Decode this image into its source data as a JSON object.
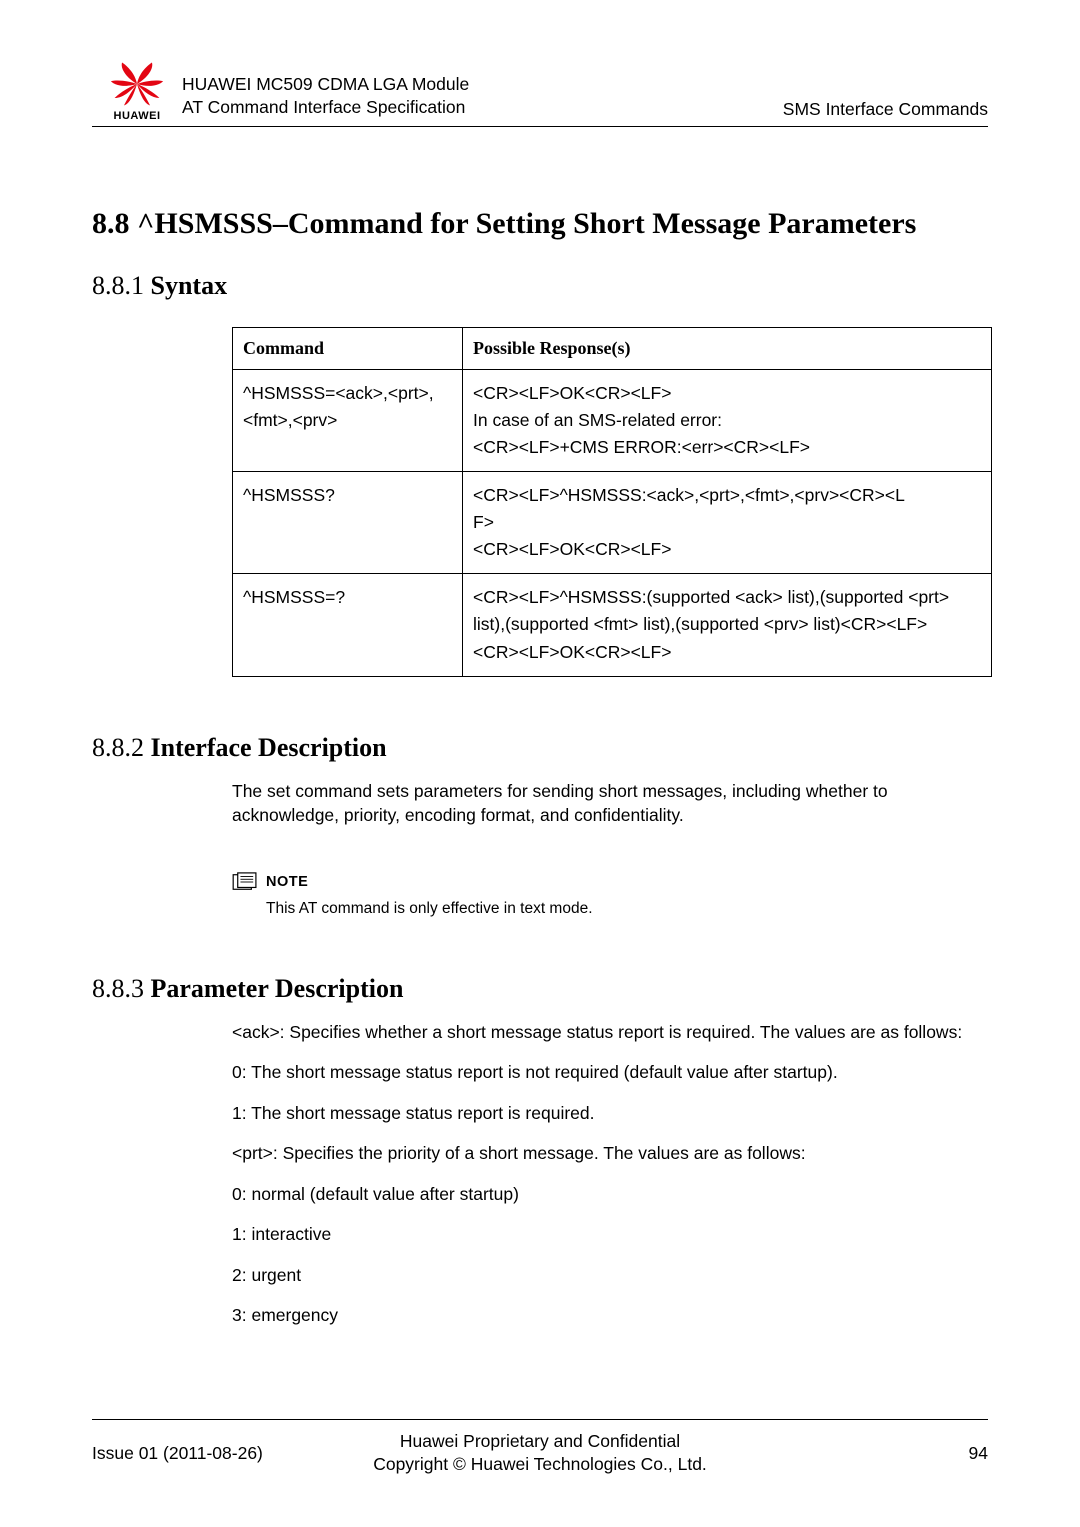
{
  "header": {
    "logo_text": "HUAWEI",
    "title_line1": "HUAWEI MC509 CDMA LGA Module",
    "title_line2": "AT Command Interface Specification",
    "right": "SMS Interface Commands"
  },
  "section": {
    "heading": "8.8 ^HSMSSS–Command for Setting Short Message Parameters",
    "sub1": {
      "num": "8.8.1 ",
      "title": "Syntax"
    },
    "sub2": {
      "num": "8.8.2 ",
      "title": "Interface Description"
    },
    "sub3": {
      "num": "8.8.3 ",
      "title": "Parameter Description"
    }
  },
  "table": {
    "head_cmd": "Command",
    "head_resp": "Possible Response(s)",
    "rows": [
      {
        "cmd": "^HSMSSS=<ack>,<prt>,<fmt>,<prv>",
        "resp": "<CR><LF>OK<CR><LF>\nIn case of an SMS-related error:\n<CR><LF>+CMS ERROR:<err><CR><LF>"
      },
      {
        "cmd": "^HSMSSS?",
        "resp": "<CR><LF>^HSMSSS:<ack>,<prt>,<fmt>,<prv><CR><LF>\n<CR><LF>OK<CR><LF>"
      },
      {
        "cmd": "^HSMSSS=?",
        "resp": "<CR><LF>^HSMSSS:(supported <ack> list),(supported <prt> list),(supported <fmt> list),(supported <prv> list)<CR><LF>\n<CR><LF>OK<CR><LF>"
      }
    ]
  },
  "interface_desc": "The set command sets parameters for sending short messages, including whether to acknowledge, priority, encoding format, and confidentiality.",
  "note": {
    "label": "NOTE",
    "text": "This AT command is only effective in text mode."
  },
  "param_desc": [
    "<ack>: Specifies whether a short message status report is required. The values are as follows:",
    "0: The short message status report is not required (default value after startup).",
    "1: The short message status report is required.",
    "<prt>: Specifies the priority of a short message. The values are as follows:",
    "0: normal (default value after startup)",
    "1: interactive",
    "2: urgent",
    "3: emergency"
  ],
  "footer": {
    "left": "Issue 01 (2011-08-26)",
    "center_line1": "Huawei Proprietary and Confidential",
    "center_line2": "Copyright © Huawei Technologies Co., Ltd.",
    "right": "94"
  }
}
